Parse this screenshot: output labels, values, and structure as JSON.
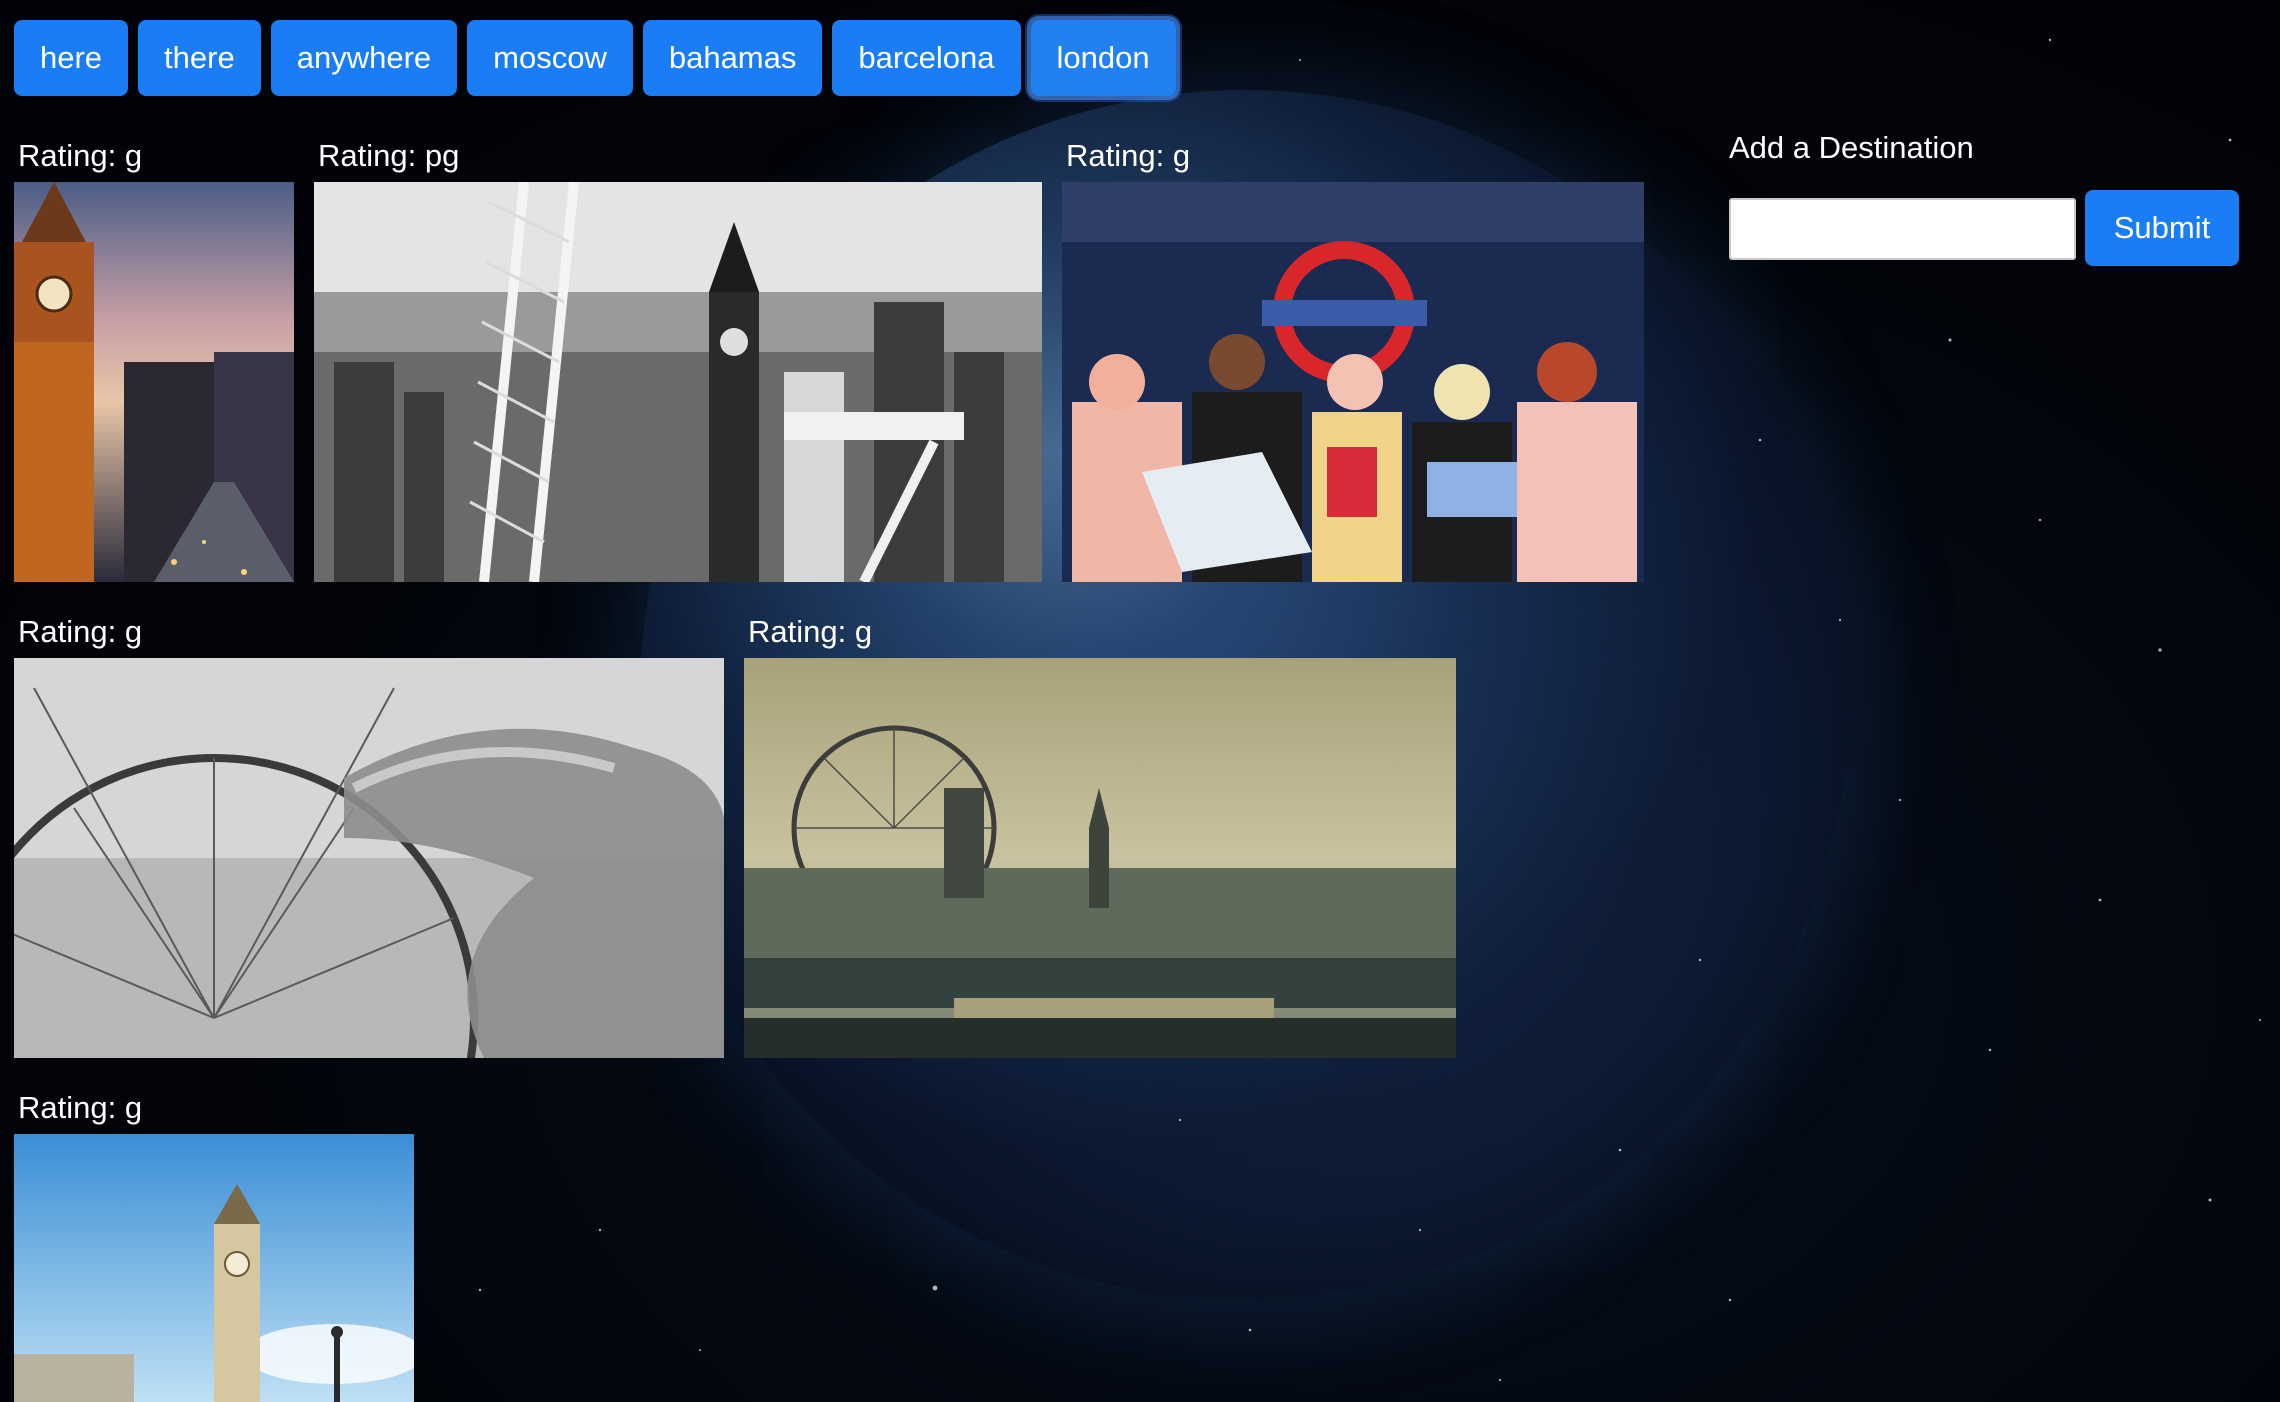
{
  "nav": {
    "buttons": [
      {
        "label": "here"
      },
      {
        "label": "there"
      },
      {
        "label": "anywhere"
      },
      {
        "label": "moscow"
      },
      {
        "label": "bahamas"
      },
      {
        "label": "barcelona"
      },
      {
        "label": "london",
        "active": true
      }
    ]
  },
  "gifs": [
    {
      "rating": "Rating: g",
      "subject": "big-ben-dusk"
    },
    {
      "rating": "Rating: pg",
      "subject": "london-eye-bw"
    },
    {
      "rating": "Rating: g",
      "subject": "tube-passengers-illustration"
    },
    {
      "rating": "Rating: g",
      "subject": "ferris-wheel-finger"
    },
    {
      "rating": "Rating: g",
      "subject": "london-skyline-thames"
    },
    {
      "rating": "Rating: g",
      "subject": "big-ben-day"
    }
  ],
  "form": {
    "title": "Add a Destination",
    "input_value": "",
    "input_placeholder": "",
    "submit_label": "Submit"
  },
  "colors": {
    "button_blue": "#1a7df5",
    "background": "#03060d"
  }
}
